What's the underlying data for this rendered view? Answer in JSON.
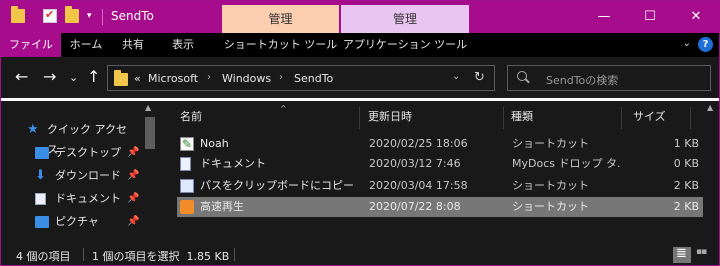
{
  "window": {
    "title": "SendTo",
    "context_tab_1": "管理",
    "context_tab_2": "管理",
    "minimize": "—",
    "maximize": "☐",
    "close": "✕",
    "dropdown_glyph": "▾"
  },
  "ribbon": {
    "tabs": [
      "ファイル",
      "ホーム",
      "共有",
      "表示",
      "ショートカット ツール",
      "アプリケーション ツール"
    ],
    "expand_glyph": "⌄",
    "help_glyph": "?"
  },
  "nav": {
    "back": "←",
    "forward": "→",
    "recent": "⌄",
    "up": "↑",
    "address": {
      "overflow": "«",
      "crumbs": [
        "Microsoft",
        "Windows",
        "SendTo"
      ],
      "separator": "›",
      "dropdown": "⌄",
      "refresh": "↻"
    },
    "search_placeholder": "SendToの検索"
  },
  "navpane": {
    "items": [
      {
        "label": "クイック アクセス",
        "icon": "star-icon",
        "pinned": false
      },
      {
        "label": "デスクトップ",
        "icon": "desktop-icon",
        "pinned": true
      },
      {
        "label": "ダウンロード",
        "icon": "download-icon",
        "pinned": true
      },
      {
        "label": "ドキュメント",
        "icon": "documents-icon",
        "pinned": true
      },
      {
        "label": "ピクチャ",
        "icon": "pictures-icon",
        "pinned": true
      }
    ],
    "pin_glyph": "📌",
    "scroll_up": "▲"
  },
  "list": {
    "columns": [
      "名前",
      "更新日時",
      "種類",
      "サイズ"
    ],
    "sort_glyph": "^",
    "rows": [
      {
        "name": "Noah",
        "date": "2020/02/25 18:06",
        "type": "ショートカット",
        "size": "1 KB",
        "icon": "noah-shortcut-icon",
        "selected": false
      },
      {
        "name": "ドキュメント",
        "date": "2020/03/12 7:46",
        "type": "MyDocs ドロップ タ...",
        "size": "0 KB",
        "icon": "document-icon",
        "selected": false
      },
      {
        "name": "パスをクリップボードにコピー",
        "date": "2020/03/04 17:58",
        "type": "ショートカット",
        "size": "2 KB",
        "icon": "clipboard-shortcut-icon",
        "selected": false
      },
      {
        "name": "高速再生",
        "date": "2020/07/22 8:08",
        "type": "ショートカット",
        "size": "2 KB",
        "icon": "speed-play-shortcut-icon",
        "selected": true
      }
    ],
    "scroll_up": "▲"
  },
  "status": {
    "item_count": "4 個の項目",
    "selection": "1 個の項目を選択  1.85 KB"
  },
  "colors": {
    "accent": "#a60c8c",
    "context_tab_1": "#fccfb1",
    "context_tab_2": "#e9c6f2",
    "selection": "#777777"
  }
}
